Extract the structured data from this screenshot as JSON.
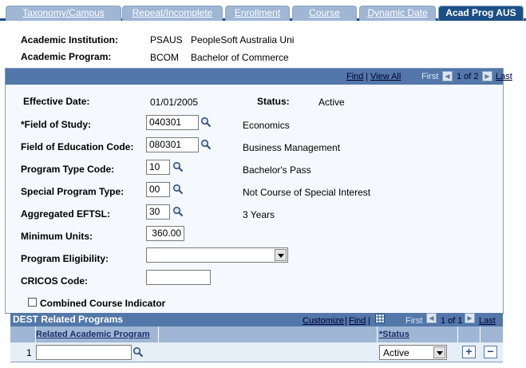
{
  "tabs": [
    {
      "label": "Taxonomy/Campus"
    },
    {
      "label": "Repeat/Incomplete"
    },
    {
      "label": "Enrollment"
    },
    {
      "label": "Course"
    },
    {
      "label": "Dynamic Date"
    },
    {
      "label": "Acad Prog AUS"
    }
  ],
  "header": {
    "institution_label": "Academic Institution:",
    "institution_code": "PSAUS",
    "institution_name": "PeopleSoft Australia Uni",
    "program_label": "Academic Program:",
    "program_code": "BCOM",
    "program_name": "Bachelor of Commerce"
  },
  "panel_nav": {
    "find": "Find",
    "sep": "|",
    "view_all": "View All",
    "first": "First",
    "count": "1 of 2",
    "last": "Last"
  },
  "form": {
    "effective_date_label": "Effective Date:",
    "effective_date": "01/01/2005",
    "status_label": "Status:",
    "status": "Active",
    "field_of_study_label": "*Field of Study:",
    "field_of_study": "040301",
    "field_of_study_desc": "Economics",
    "field_of_education_label": "Field of Education Code:",
    "field_of_education": "080301",
    "field_of_education_desc": "Business Management",
    "program_type_label": "Program Type Code:",
    "program_type": "10",
    "program_type_desc": "Bachelor's Pass",
    "special_program_label": "Special Program Type:",
    "special_program": "00",
    "special_program_desc": "Not Course of Special Interest",
    "eftsl_label": "Aggregated EFTSL:",
    "eftsl": "30",
    "eftsl_desc": "3 Years",
    "min_units_label": "Minimum Units:",
    "min_units": "360.00",
    "eligibility_label": "Program Eligibility:",
    "eligibility": "",
    "cricos_label": "CRICOS Code:",
    "cricos": "",
    "combined_label": "Combined Course Indicator"
  },
  "grid": {
    "title": "DEST Related Programs",
    "customize": "Customize",
    "sep": "|",
    "find": "Find",
    "first": "First",
    "count": "1 of 1",
    "last": "Last",
    "col_related": "Related Academic Program",
    "col_status": "*Status",
    "rows": [
      {
        "num": "1",
        "related": "",
        "status": "Active"
      }
    ]
  },
  "colors": {
    "tab_active": "#1c4f86",
    "bar": "#5277a8",
    "panel_bg": "#f5f8fc"
  }
}
